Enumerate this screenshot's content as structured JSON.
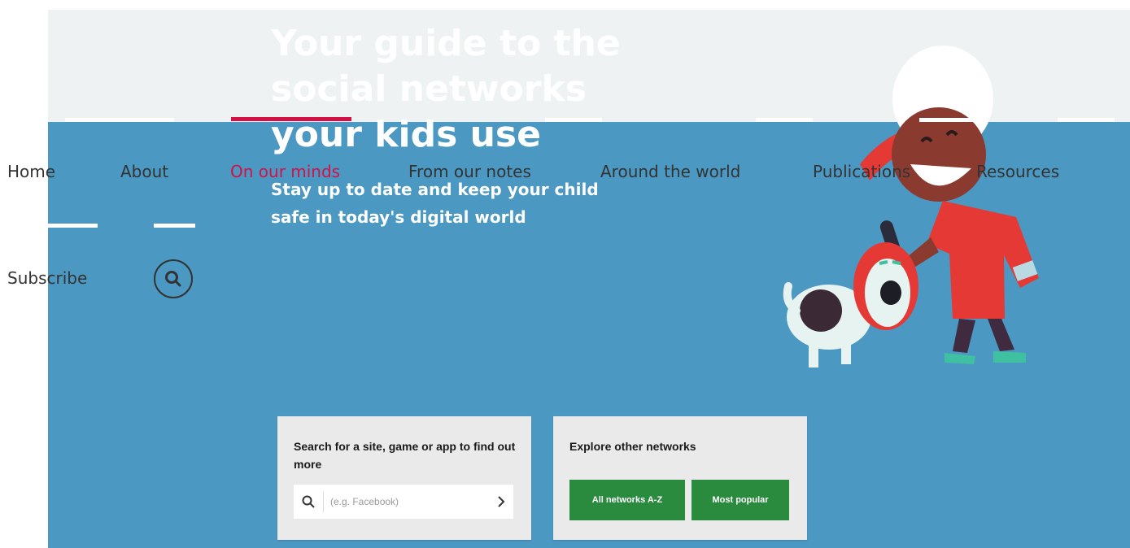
{
  "hero": {
    "title_line1": "Your guide to the",
    "title_line2": "social networks",
    "title_line3": "your kids use",
    "subtitle_line1": "Stay up to date and keep your child",
    "subtitle_line2": "safe in today's digital world"
  },
  "search_panel": {
    "title": "Search for a site, game or app to find out more",
    "placeholder": "(e.g. Facebook)",
    "icon": "search-icon",
    "submit_icon": "chevron-right-icon"
  },
  "explore_panel": {
    "title": "Explore other networks",
    "all_networks_label": "All networks A-Z",
    "most_popular_label": "Most popular"
  },
  "nav": {
    "items": [
      {
        "label": "Home"
      },
      {
        "label": "About"
      },
      {
        "label": "On our minds",
        "active": true
      },
      {
        "label": "From our notes"
      },
      {
        "label": "Around the world"
      },
      {
        "label": "Publications"
      },
      {
        "label": "Resources"
      }
    ],
    "subscribe_label": "Subscribe",
    "search_icon": "search-icon"
  },
  "colors": {
    "hero_blue": "#4b98c2",
    "active_nav": "#d31145",
    "button_green": "#2a8a3e",
    "panel_grey": "#eaeaea"
  }
}
